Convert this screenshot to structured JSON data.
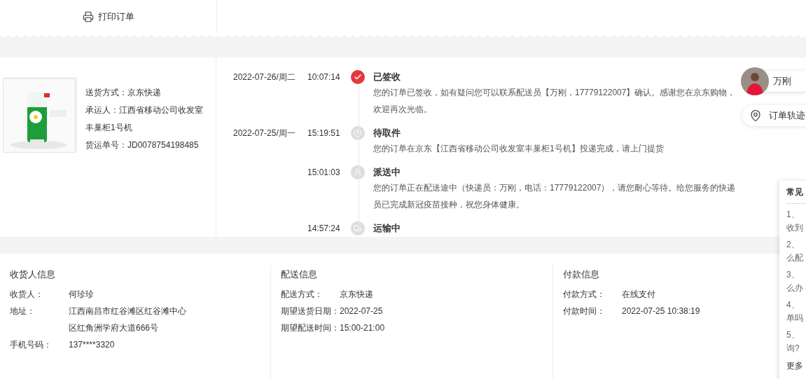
{
  "toolbar": {
    "print_label": "打印订单"
  },
  "shipment": {
    "picture": {
      "kind": "picture"
    },
    "fields": [
      "送货方式：京东快递",
      "承运人：江西省移动公司收发室丰巢柜1号机",
      "货运单号：JD0078754198485"
    ]
  },
  "tracking": [
    {
      "date": "2022-07-26/周二",
      "time": "10:07:14",
      "status": "已签收",
      "description": "您的订单已签收，如有疑问您可以联系配送员【万刚，17779122007】确认。感谢您在京东购物，欢迎再次光临。",
      "kind": "signed",
      "current": true
    },
    {
      "date": "2022-07-25/周一",
      "time": "15:19:51",
      "status": "待取件",
      "description": "您的订单在京东【江西省移动公司收发室丰巢柜1号机】投递完成，请上门提货",
      "kind": "pickup",
      "current": false
    },
    {
      "time": "15:01:03",
      "status": "派送中",
      "description": "您的订单正在配送途中（快递员：万刚，电话：17779122007），请您耐心等待。给您服务的快递员已完成新冠疫苗接种，祝您身体健康。",
      "kind": "delivering",
      "current": false
    },
    {
      "time": "14:57:24",
      "status": "运输中",
      "kind": "transit",
      "current": false
    }
  ],
  "courier": {
    "name": "万刚"
  },
  "track_button": {
    "label": "订单轨迹"
  },
  "info_sections": [
    {
      "title": "收货人信息",
      "rows": [
        {
          "label": "收货人：",
          "value": "何珍珍"
        },
        {
          "label": "地址：",
          "value": "江西南昌市红谷滩区红谷滩中心区红角洲学府大道666号"
        },
        {
          "label": "手机号码：",
          "value": "137****3320"
        }
      ]
    },
    {
      "title": "配送信息",
      "rows": [
        {
          "label": "配送方式：",
          "value": "京东快递"
        },
        {
          "label": "期望送货日期：",
          "value": "2022-07-25"
        },
        {
          "label": "期望配送时间：",
          "value": "15:00-21:00"
        }
      ]
    },
    {
      "title": "付款信息",
      "rows": [
        {
          "label": "付款方式：",
          "value": "在线支付"
        },
        {
          "label": "付款时间：",
          "value": "2022-07-25 10:38:19"
        }
      ]
    }
  ],
  "faq": {
    "title": "常见",
    "items": [
      [
        "1、",
        "收到"
      ],
      [
        "2、",
        "么配"
      ],
      [
        "3、",
        "么办"
      ],
      [
        "4、",
        "单吗"
      ],
      [
        "5、",
        "询?"
      ]
    ],
    "more": "更多"
  }
}
